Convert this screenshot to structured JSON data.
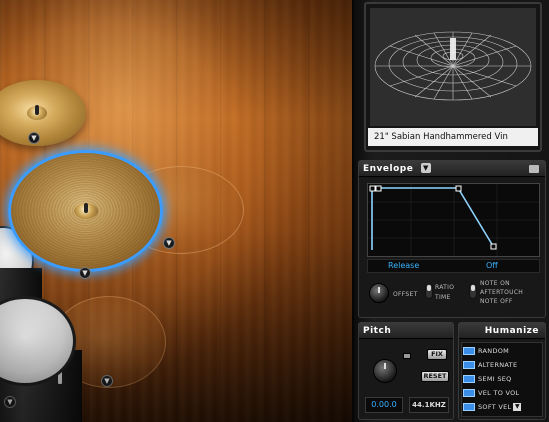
{
  "instrument": {
    "name": "21\" Sabian Handhammered Vin"
  },
  "envelope": {
    "title": "Envelope",
    "param_label": "Release",
    "param_value": "Off",
    "knob_label": "OFFSET",
    "ratio_label": "RATIO",
    "time_label": "TIME",
    "note_on_label": "NOTE ON",
    "aftertouch_label": "AFTERTOUCH",
    "note_off_label": "NOTE OFF"
  },
  "pitch": {
    "title": "Pitch",
    "fix_label": "FIX",
    "reset_label": "RESET",
    "value": "0.00.0",
    "rate": "44.1KHZ"
  },
  "humanize": {
    "title": "Humanize",
    "options": [
      {
        "label": "RANDOM",
        "checked": true
      },
      {
        "label": "ALTERNATE",
        "checked": true
      },
      {
        "label": "SEMI SEQ",
        "checked": true
      },
      {
        "label": "VEL TO VOL",
        "checked": true
      },
      {
        "label": "SOFT VEL",
        "checked": true
      }
    ]
  },
  "colors": {
    "selection": "#3a9cff",
    "readout": "#3ab3ff",
    "envelope_line": "#8cd4ff"
  }
}
